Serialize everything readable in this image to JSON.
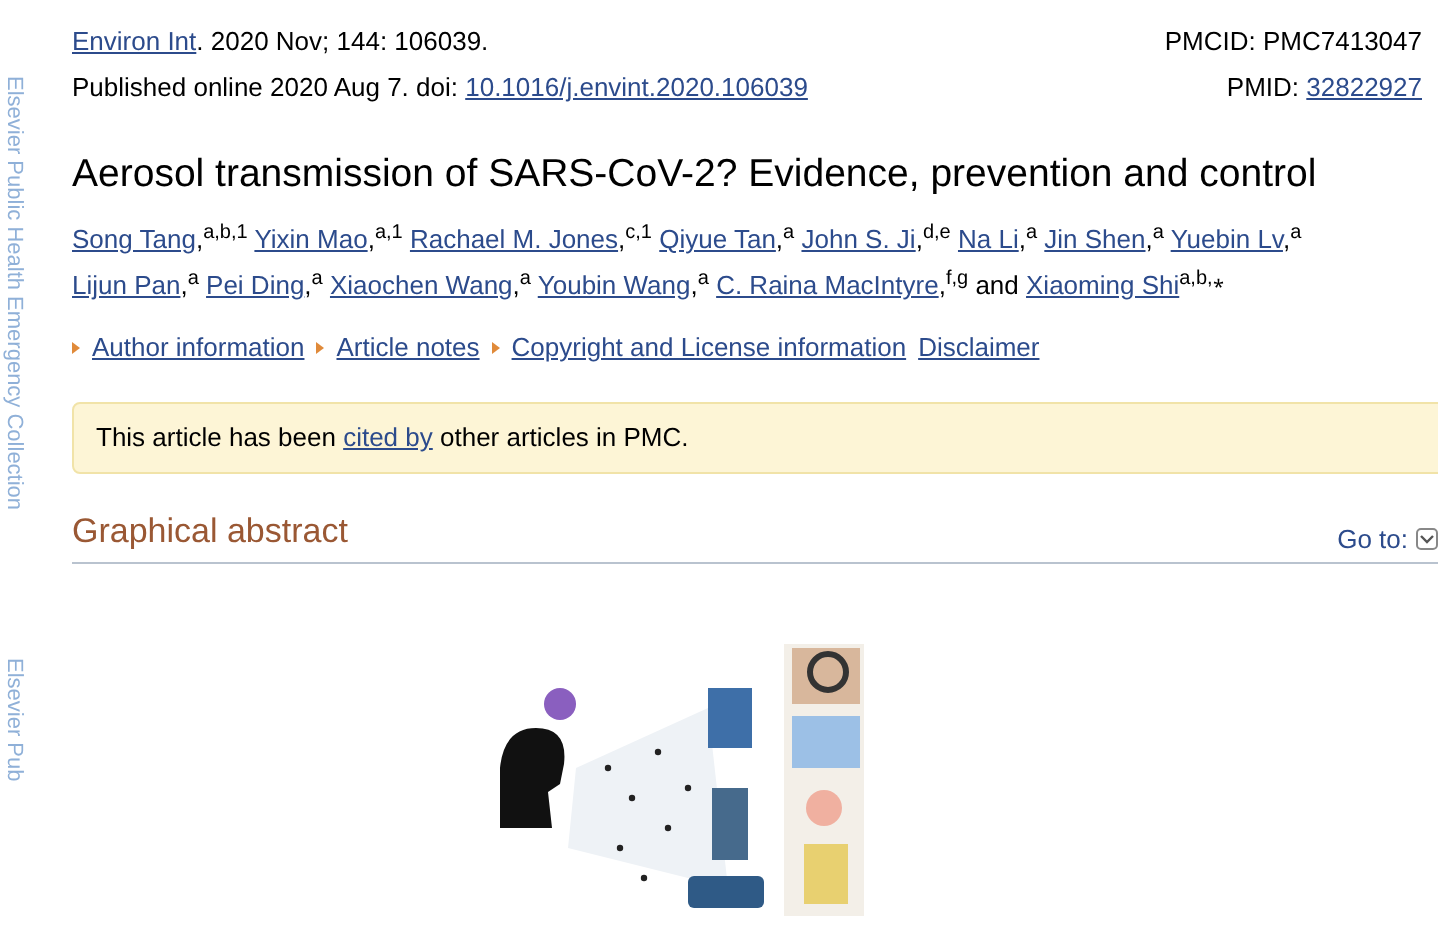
{
  "side_banner": [
    "Elsevier Public Health Emergency Collection",
    "Elsevier Pub"
  ],
  "citation": {
    "journal": "Environ Int",
    "rest": ". 2020 Nov; 144: 106039.",
    "pmcid": "PMCID: PMC7413047"
  },
  "published": {
    "text": "Published online 2020 Aug 7. doi: ",
    "doi": "10.1016/j.envint.2020.106039",
    "pmid_label": "PMID: ",
    "pmid": "32822927"
  },
  "title": "Aerosol transmission of SARS-CoV-2? Evidence, prevention and control",
  "authors": [
    {
      "name": "Song Tang",
      "punct": ",",
      "sup": "a,b,1"
    },
    {
      "name": "Yixin Mao",
      "punct": ",",
      "sup": "a,1"
    },
    {
      "name": "Rachael M. Jones",
      "punct": ",",
      "sup": "c,1"
    },
    {
      "name": "Qiyue Tan",
      "punct": ",",
      "sup": "a"
    },
    {
      "name": "John S. Ji",
      "punct": ",",
      "sup": "d,e"
    },
    {
      "name": "Na Li",
      "punct": ",",
      "sup": "a"
    },
    {
      "name": "Jin Shen",
      "punct": ",",
      "sup": "a"
    },
    {
      "name": "Yuebin Lv",
      "punct": ",",
      "sup": "a"
    },
    {
      "name": "Lijun Pan",
      "punct": ",",
      "sup": "a"
    },
    {
      "name": "Pei Ding",
      "punct": ",",
      "sup": "a"
    },
    {
      "name": "Xiaochen Wang",
      "punct": ",",
      "sup": "a"
    },
    {
      "name": "Youbin Wang",
      "punct": ",",
      "sup": "a"
    },
    {
      "name": "C. Raina MacIntyre",
      "punct": ",",
      "sup": "f,g",
      "after": "and"
    },
    {
      "name": "Xiaoming Shi",
      "sup": "a,b,⁎"
    }
  ],
  "article_links": [
    {
      "label": "Author information",
      "kind": "expander"
    },
    {
      "label": "Article notes",
      "kind": "expander"
    },
    {
      "label": "Copyright and License information",
      "kind": "expander"
    },
    {
      "label": "Disclaimer",
      "kind": "link"
    }
  ],
  "notice": {
    "before": "This article has been ",
    "link": "cited by",
    "after": " other articles in PMC."
  },
  "section": {
    "heading": "Graphical abstract",
    "goto": "Go to:"
  }
}
